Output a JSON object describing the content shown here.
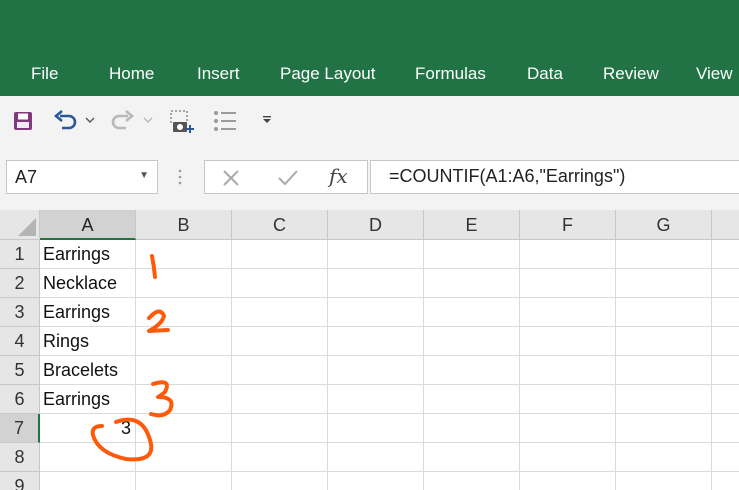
{
  "ribbon": {
    "tabs": [
      "File",
      "Home",
      "Insert",
      "Page Layout",
      "Formulas",
      "Data",
      "Review",
      "View"
    ],
    "color": "#217346"
  },
  "qat": {
    "icons": [
      "save-icon",
      "undo-icon",
      "redo-icon",
      "camera-icon",
      "list-icon",
      "customize-icon"
    ]
  },
  "formula_bar": {
    "name_box": "A7",
    "cancel_icon": "cancel-icon",
    "enter_icon": "check-icon",
    "fx_label": "fx",
    "formula": "=COUNTIF(A1:A6,\"Earrings\")"
  },
  "sheet": {
    "columns": [
      "A",
      "B",
      "C",
      "D",
      "E",
      "F",
      "G"
    ],
    "rows": [
      "1",
      "2",
      "3",
      "4",
      "5",
      "6",
      "7",
      "8",
      "9"
    ],
    "column_a": [
      "Earrings",
      "Necklace",
      "Earrings",
      "Rings",
      "Bracelets",
      "Earrings",
      "3",
      "",
      ""
    ],
    "active_cell": "A7",
    "annotations": [
      "1",
      "2",
      "3"
    ],
    "annotation_color": "#ff5a0a"
  }
}
